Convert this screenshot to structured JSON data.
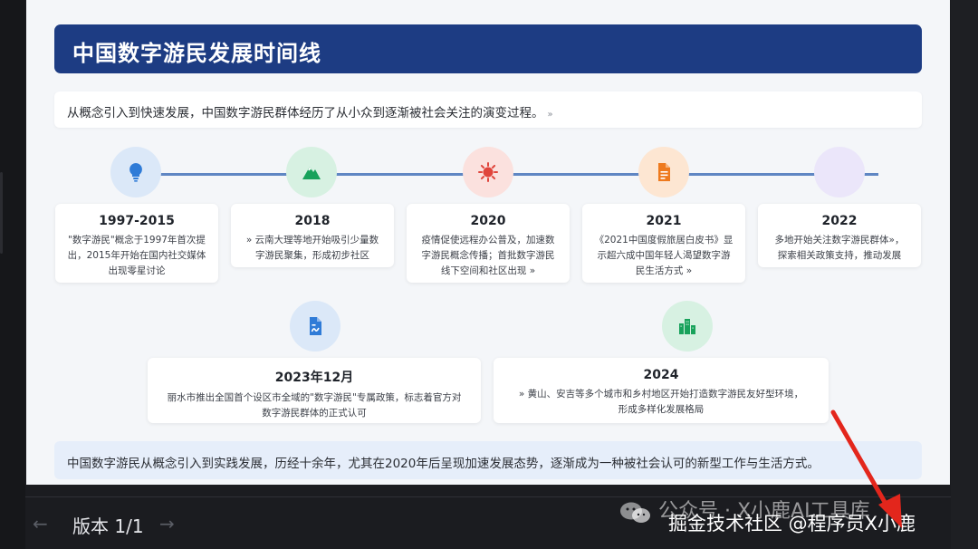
{
  "slide": {
    "title": "中国数字游民发展时间线",
    "intro": "从概念引入到快速发展，中国数字游民群体经历了从小众到逐渐被社会关注的演变过程。",
    "ref_mark": "»",
    "events": [
      {
        "year": "1997-2015",
        "desc_lines": [
          "\"数字游民\"概念于1997年首次提",
          "出，2015年开始在国内社交媒体",
          "出现零星讨论"
        ],
        "icon": "lightbulb-icon",
        "color": "#2f7bd7",
        "bg": "#dbe8f8"
      },
      {
        "year": "2018",
        "desc_lines": [
          "» 云南大理等地开始吸引少量数",
          "字游民聚集，形成初步社区"
        ],
        "icon": "mountain-icon",
        "color": "#18a25b",
        "bg": "#d7f1e2"
      },
      {
        "year": "2020",
        "desc_lines": [
          "疫情促使远程办公普及，加速数",
          "字游民概念传播；首批数字游民",
          "线下空间和社区出现 »"
        ],
        "icon": "virus-icon",
        "color": "#e0453c",
        "bg": "#fbe1de"
      },
      {
        "year": "2021",
        "desc_lines": [
          "《2021中国度假旅居白皮书》显",
          "示超六成中国年轻人渴望数字游",
          "民生活方式 »"
        ],
        "icon": "document-icon",
        "color": "#ee7a1e",
        "bg": "#fde6d2"
      },
      {
        "year": "2022",
        "desc_lines": [
          "多地开始关注数字游民群体»，",
          "探索相关政策支持，推动发展"
        ],
        "icon": "",
        "color": "#8b6fd6",
        "bg": "#ebe6fa"
      },
      {
        "year": "2023年12月",
        "desc_lines": [
          "丽水市推出全国首个设区市全域的\"数字游民\"专属政策，标志着官方对",
          "数字游民群体的正式认可"
        ],
        "icon": "policy-file-icon",
        "color": "#2f7bd7",
        "bg": "#dbe8f8"
      },
      {
        "year": "2024",
        "desc_lines": [
          "» 黄山、安吉等多个城市和乡村地区开始打造数字游民友好型环境，",
          "形成多样化发展格局"
        ],
        "icon": "city-buildings-icon",
        "color": "#18a25b",
        "bg": "#d7f1e2"
      }
    ],
    "summary": "中国数字游民从概念引入到实践发展，历经十余年，尤其在2020年后呈现加速发展态势，逐渐成为一种被社会认可的新型工作与生活方式。",
    "line_color": "#5f86c3",
    "title_bg": "#1d3c83"
  },
  "footer": {
    "prev": "←",
    "version": "版本 1/1",
    "next": "→"
  },
  "watermark": {
    "account": "公众号 · X小鹿AI工具库",
    "community": "掘金技术社区 @程序员X小鹿"
  }
}
